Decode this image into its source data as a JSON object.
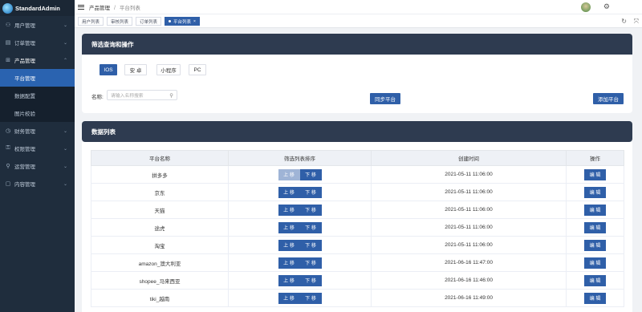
{
  "brand": {
    "title": "StandardAdmin"
  },
  "sidebar": {
    "items": [
      {
        "label": "用户管理",
        "icon": "user-icon"
      },
      {
        "label": "订单管理",
        "icon": "order-icon"
      },
      {
        "label": "产品管理",
        "icon": "grid-icon",
        "open": true,
        "children": [
          {
            "label": "平台管理",
            "active": true
          },
          {
            "label": "数据配置"
          },
          {
            "label": "图片校验"
          }
        ]
      },
      {
        "label": "财务管理",
        "icon": "finance-icon"
      },
      {
        "label": "权限管理",
        "icon": "lock-icon"
      },
      {
        "label": "运营管理",
        "icon": "operation-icon"
      },
      {
        "label": "内容管理",
        "icon": "content-icon"
      }
    ]
  },
  "header": {
    "breadcrumb_parent": "产品管理",
    "breadcrumb_sep": "/",
    "breadcrumb_current": "平台列表"
  },
  "tabs": [
    {
      "label": "用户列表"
    },
    {
      "label": "审核列表"
    },
    {
      "label": "订单列表"
    },
    {
      "label": "平台列表",
      "active": true,
      "close": "×"
    }
  ],
  "filter": {
    "title": "筛选查询和操作",
    "toggles": [
      "IOS",
      "安 卓",
      "小程序",
      "PC"
    ],
    "name_label": "名称:",
    "search_placeholder": "请输入名称搜索",
    "sync_button": "同步平台",
    "add_button": "添加平台"
  },
  "list": {
    "title": "数据列表",
    "columns": [
      "平台名称",
      "筛选列表排序",
      "创建时间",
      "操作"
    ],
    "move_up": "上 移",
    "move_down": "下 移",
    "edit": "编 辑",
    "rows": [
      {
        "name": "拼多多",
        "time": "2021-05-11 11:06:00"
      },
      {
        "name": "京东",
        "time": "2021-05-11 11:06:00"
      },
      {
        "name": "天猫",
        "time": "2021-05-11 11:06:00"
      },
      {
        "name": "途虎",
        "time": "2021-05-11 11:06:00"
      },
      {
        "name": "淘宝",
        "time": "2021-05-11 11:06:00"
      },
      {
        "name": "amazon_澳大利亚",
        "time": "2021-06-16 11:47:00"
      },
      {
        "name": "shopee_马来西亚",
        "time": "2021-06-16 11:46:00"
      },
      {
        "name": "tiki_越南",
        "time": "2021-06-16 11:49:00"
      }
    ]
  },
  "colors": {
    "sidebar_bg": "#1f2d3d",
    "primary": "#2f5fa8",
    "panel_head": "#2e3b50"
  }
}
